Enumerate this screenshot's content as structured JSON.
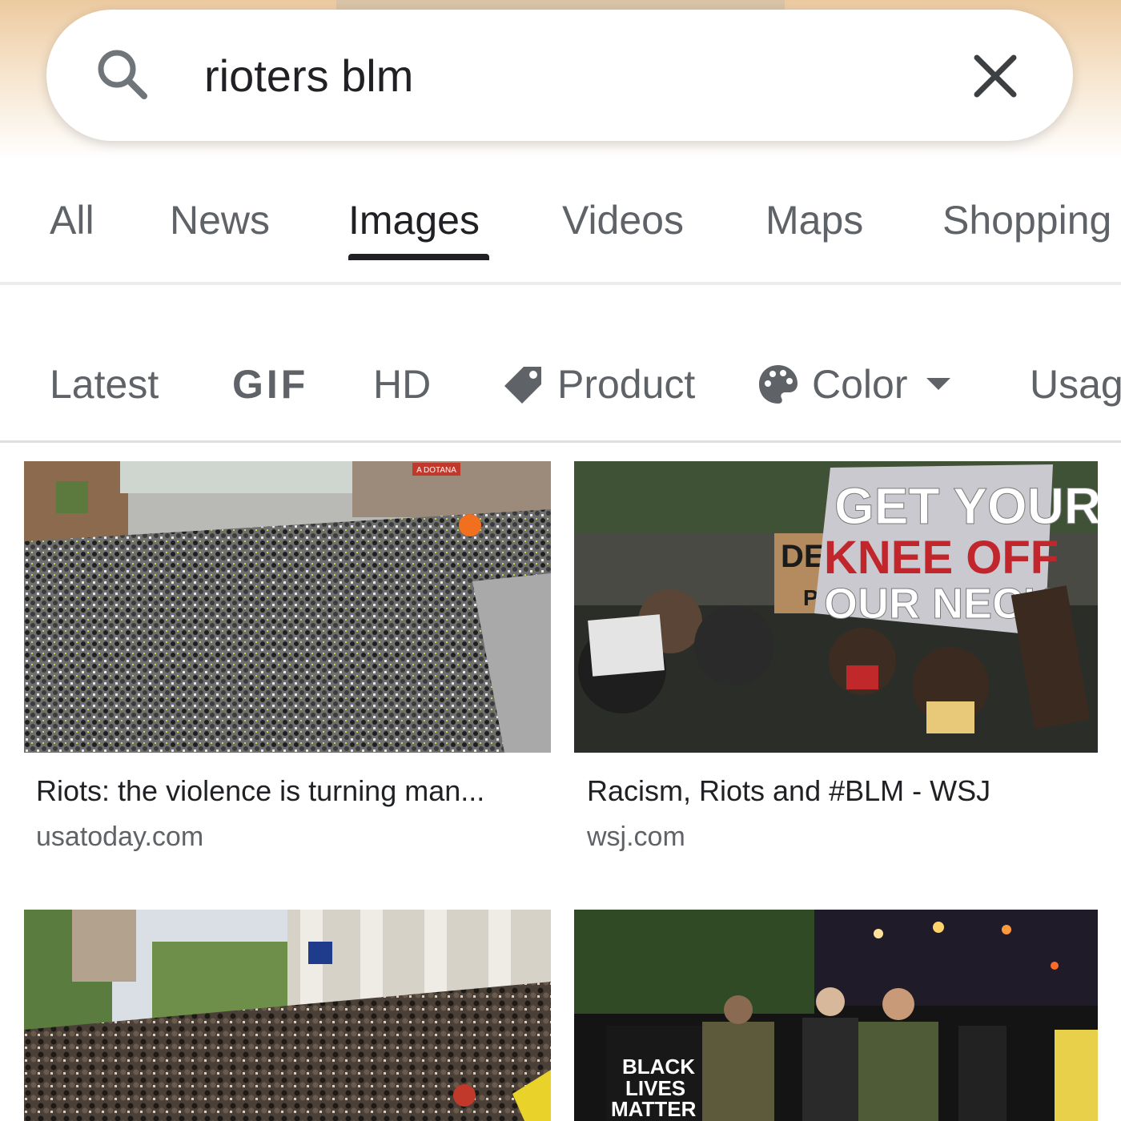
{
  "search": {
    "query": "rioters blm"
  },
  "tabs": [
    {
      "label": "All"
    },
    {
      "label": "News"
    },
    {
      "label": "Images"
    },
    {
      "label": "Videos"
    },
    {
      "label": "Maps"
    },
    {
      "label": "Shopping"
    }
  ],
  "active_tab": "Images",
  "chips": {
    "latest": "Latest",
    "gif": "GIF",
    "hd": "HD",
    "product": "Product",
    "color": "Color",
    "usage": "Usage"
  },
  "results": [
    {
      "title": "Riots: the violence is turning man...",
      "source": "usatoday.com",
      "image_text": [
        "A DOTANA"
      ]
    },
    {
      "title": "Racism, Riots and #BLM - WSJ",
      "source": "wsj.com",
      "image_text": [
        "GET YOUR",
        "KNEE OFF",
        "OUR NECK",
        "DE",
        "P"
      ]
    },
    {
      "title": "",
      "source": "",
      "image_text": []
    },
    {
      "title": "",
      "source": "",
      "image_text": [
        "BLACK",
        "LIVES",
        "MATTER"
      ]
    }
  ],
  "icons": {
    "search": "search-icon",
    "clear": "close-icon",
    "product": "tag-icon",
    "color": "palette-icon",
    "dropdown": "caret-down-icon"
  },
  "colors": {
    "text_primary": "#202124",
    "text_secondary": "#5f6368",
    "top_gradient": "#eccaa0"
  }
}
